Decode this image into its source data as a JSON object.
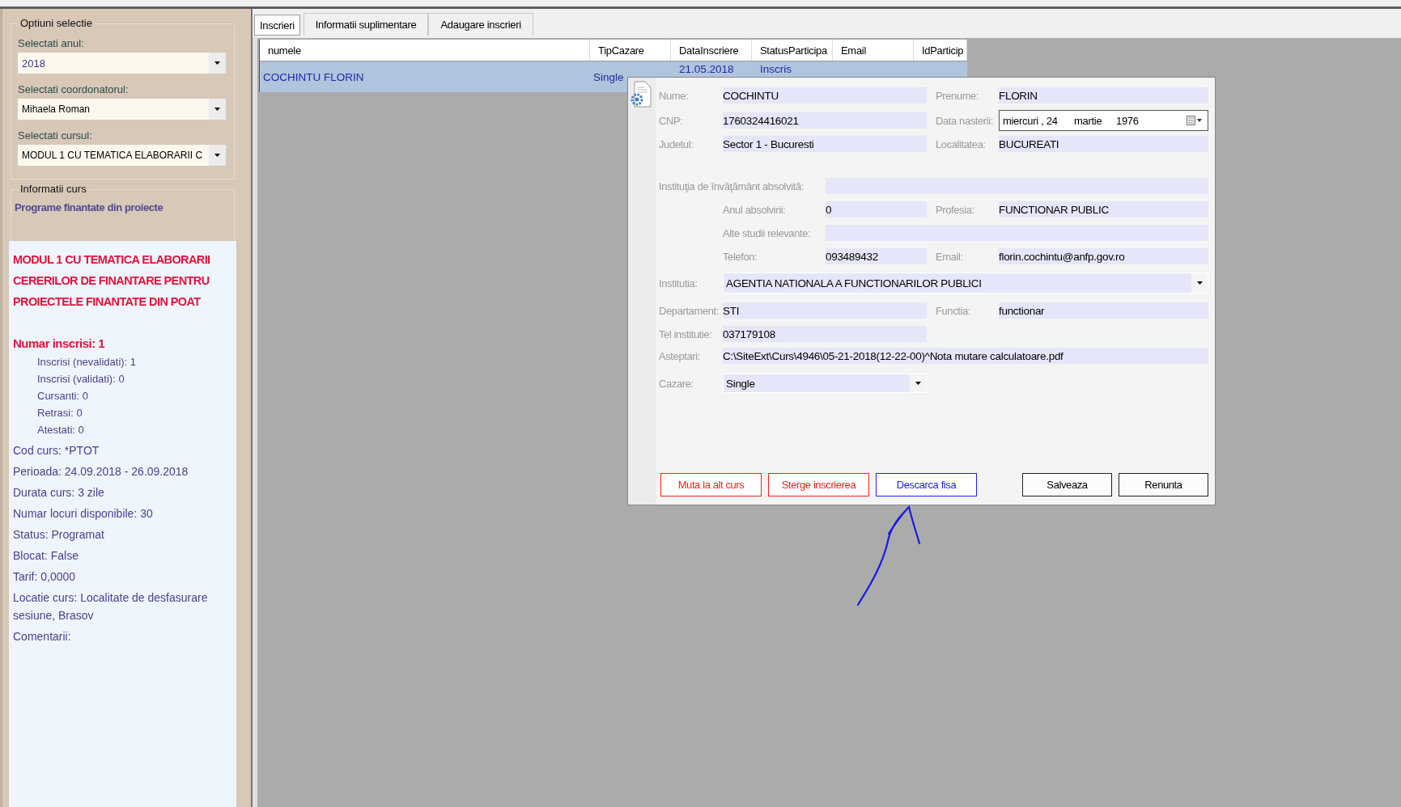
{
  "sidebar": {
    "options": {
      "title": "Optiuni selectie",
      "selects": [
        {
          "label": "Selectati anul:",
          "value": "2018",
          "kind": "year"
        },
        {
          "label": "Selectati coordonatorul:",
          "value": "Mihaela Roman",
          "kind": "plain"
        },
        {
          "label": "Selectati cursul:",
          "value": "MODUL 1 CU TEMATICA ELABORARII C",
          "kind": "plain"
        }
      ]
    },
    "info": {
      "title": "Informatii curs",
      "program": "Programe finantate din proiecte",
      "course_title": "MODUL 1 CU TEMATICA ELABORARII CERERILOR DE FINANTARE PENTRU PROIECTELE FINANTATE DIN POAT",
      "enrolled": "Numar inscrisi: 1",
      "enrolled_breakdown": [
        "Inscrisi (nevalidati): 1",
        "Inscrisi (validati): 0",
        "Cursanti: 0",
        "Retrasi: 0",
        "Atestati: 0"
      ],
      "details": [
        "Cod curs: *PTOT",
        "Perioada: 24.09.2018 - 26.09.2018",
        "Durata curs: 3 zile",
        "Numar locuri disponibile: 30",
        "Status: Programat",
        "Blocat: False",
        "Tarif: 0,0000",
        "Locatie curs: Localitate de desfasurare sesiune, Brasov",
        "Comentarii:"
      ]
    }
  },
  "tabs": [
    {
      "label": "Inscrieri",
      "selected": true
    },
    {
      "label": "Informatii suplimentare",
      "selected": false
    },
    {
      "label": "Adaugare inscrieri",
      "selected": false
    }
  ],
  "table": {
    "columns": [
      "numele",
      "TipCazare",
      "DataInscriere",
      "StatusParticipa",
      "Email",
      "IdParticip"
    ],
    "rows": [
      {
        "selected": true,
        "cells": [
          "COCHINTU FLORIN",
          "Single",
          "21.05.2018",
          "Inscris"
        ]
      }
    ]
  },
  "dialog": {
    "nume": {
      "label": "Nume:",
      "value": "COCHINTU"
    },
    "prenume": {
      "label": "Prenume:",
      "value": "FLORIN"
    },
    "cnp": {
      "label": "CNP:",
      "value": "1760324416021"
    },
    "data_nasterii": {
      "label": "Data nasterii:",
      "day": "miercuri , 24",
      "month": "martie",
      "year": "1976"
    },
    "judetul": {
      "label": "Judetul:",
      "value": "Sector 1 - Bucuresti"
    },
    "localitatea": {
      "label": "Localitatea:",
      "value": "BUCUREATI"
    },
    "institutia_inv": {
      "label": "Instituţia de învăţământ absolvită:"
    },
    "anul": {
      "label": "Anul absolvirii:",
      "value": "0"
    },
    "profesia": {
      "label": "Profesia:",
      "value": "FUNCTIONAR PUBLIC"
    },
    "alte": {
      "label": "Alte studii relevante:"
    },
    "telefon": {
      "label": "Telefon:",
      "value": "093489432"
    },
    "email": {
      "label": "Email:",
      "value": "florin.cochintu@anfp.gov.ro"
    },
    "institutia": {
      "label": "Institutia:",
      "value": "AGENTIA NATIONALA A FUNCTIONARILOR PUBLICI"
    },
    "departament": {
      "label": "Departament:",
      "value": "STI"
    },
    "functia": {
      "label": "Functia:",
      "value": "functionar"
    },
    "tel_inst": {
      "label": "Tel institutie:",
      "value": "037179108"
    },
    "asteptari": {
      "label": "Asteptari:",
      "value": "C:\\SiteExt\\Curs\\4946\\05-21-2018(12-22-00)^Nota mutare calculatoare.pdf"
    },
    "cazare": {
      "label": "Cazare:",
      "value": "Single"
    },
    "buttons": [
      {
        "label": "Muta la alt curs",
        "kind": "danger"
      },
      {
        "label": "Sterge inscrierea",
        "kind": "danger"
      },
      {
        "label": "Descarca fisa",
        "kind": "primary"
      },
      {
        "label": "Salveaza",
        "kind": "default"
      },
      {
        "label": "Renunta",
        "kind": "default"
      }
    ]
  }
}
